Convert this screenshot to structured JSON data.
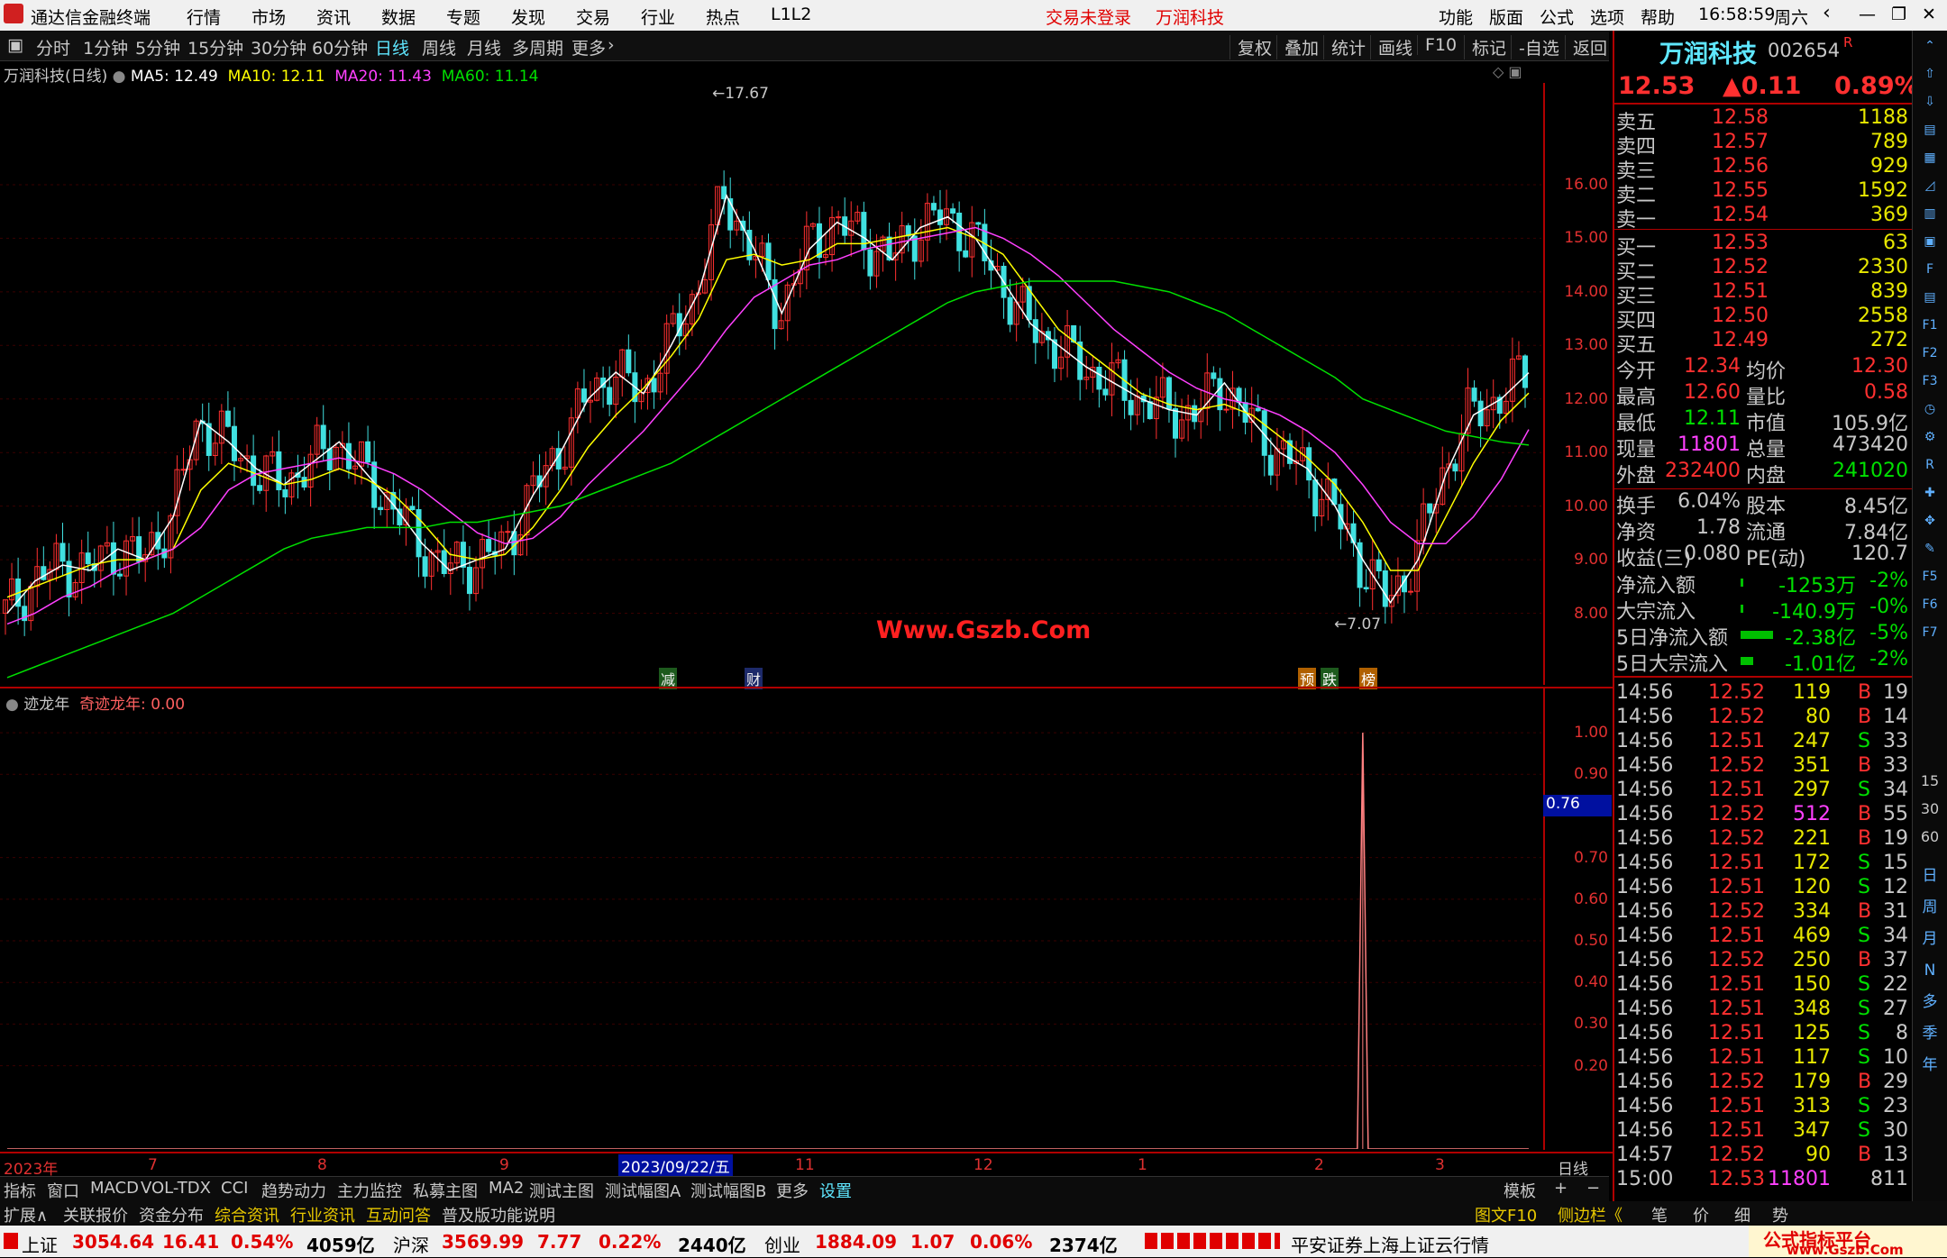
{
  "titlebar": {
    "app_title": "通达信金融终端",
    "menu": [
      "行情",
      "市场",
      "资讯",
      "数据",
      "专题",
      "发现",
      "交易",
      "行业",
      "热点",
      "L1L2"
    ],
    "trade_status": "交易未登录",
    "stock_name": "万润科技",
    "right_menu": [
      "功能",
      "版面",
      "公式",
      "选项",
      "帮助"
    ],
    "time": "16:58:59",
    "weekday": "周六"
  },
  "periodbar": {
    "periods": [
      "分时",
      "1分钟",
      "5分钟",
      "15分钟",
      "30分钟",
      "60分钟",
      "日线",
      "周线",
      "月线",
      "多周期",
      "更多"
    ],
    "selected": "日线",
    "tools": [
      "复权",
      "叠加",
      "统计",
      "画线",
      "F10",
      "标记",
      "-自选",
      "返回"
    ]
  },
  "main_chart": {
    "legend_name": "万润科技(日线)",
    "ma": [
      {
        "label": "MA5: 12.49",
        "color": "#ffffff"
      },
      {
        "label": "MA10: 12.11",
        "color": "#ffff00"
      },
      {
        "label": "MA20: 11.43",
        "color": "#ff40ff"
      },
      {
        "label": "MA60: 11.14",
        "color": "#00e000"
      }
    ],
    "high_mark": "17.67",
    "low_mark": "7.07",
    "watermark": "Www.Gszb.Com",
    "events": [
      "减",
      "财",
      "预",
      "跌",
      "榜"
    ]
  },
  "indicator": {
    "legend_name": "迹龙年",
    "legend_value": "奇迹龙年: 0.00",
    "cursor_value": "0.76"
  },
  "xaxis": {
    "labels": [
      "2023年",
      "7",
      "8",
      "9",
      "2023/09/22/五",
      "11",
      "12",
      "1",
      "2",
      "3"
    ],
    "right": "日线"
  },
  "chart_data": [
    {
      "type": "candlestick",
      "title": "万润科技(日线)",
      "y_ticks": [
        "16.00",
        "15.00",
        "14.00",
        "13.00",
        "12.00",
        "11.00",
        "10.00",
        "9.00",
        "8.00"
      ],
      "ylim": [
        7.0,
        17.9
      ],
      "series": [
        {
          "name": "MA5",
          "color": "#ffffff",
          "values": [
            8.0,
            8.6,
            8.9,
            8.8,
            9.2,
            9.0,
            9.8,
            11.6,
            11.2,
            10.7,
            10.4,
            10.8,
            11.2,
            10.6,
            10.0,
            9.3,
            8.8,
            9.0,
            9.2,
            10.2,
            11.0,
            12.0,
            12.5,
            12.1,
            13.0,
            14.0,
            15.8,
            14.8,
            13.6,
            14.8,
            15.3,
            15.0,
            14.6,
            15.2,
            15.4,
            15.0,
            14.2,
            13.4,
            13.0,
            12.6,
            12.3,
            12.0,
            11.8,
            11.7,
            12.3,
            11.6,
            11.0,
            10.7,
            10.0,
            9.0,
            8.2,
            9.0,
            10.6,
            11.7,
            12.0,
            12.49
          ]
        },
        {
          "name": "MA10",
          "color": "#ffff00",
          "values": [
            8.3,
            8.5,
            8.7,
            8.9,
            9.0,
            9.0,
            9.2,
            10.3,
            10.8,
            10.6,
            10.4,
            10.5,
            10.7,
            10.5,
            10.2,
            9.7,
            9.1,
            9.0,
            9.1,
            9.6,
            10.3,
            11.1,
            11.7,
            12.2,
            12.8,
            13.5,
            14.6,
            14.7,
            14.5,
            14.6,
            14.9,
            14.9,
            15.0,
            15.1,
            15.2,
            15.0,
            14.7,
            14.0,
            13.3,
            12.9,
            12.5,
            12.1,
            11.9,
            11.8,
            11.9,
            11.7,
            11.3,
            10.9,
            10.4,
            9.7,
            8.8,
            8.8,
            9.8,
            10.8,
            11.6,
            12.11
          ]
        },
        {
          "name": "MA20",
          "color": "#ff40ff",
          "values": [
            7.8,
            8.0,
            8.3,
            8.5,
            8.8,
            9.0,
            9.2,
            9.6,
            10.3,
            10.6,
            10.7,
            10.8,
            10.9,
            10.8,
            10.6,
            10.3,
            9.9,
            9.5,
            9.3,
            9.4,
            9.8,
            10.4,
            10.9,
            11.4,
            12.0,
            12.6,
            13.3,
            13.9,
            14.2,
            14.5,
            14.6,
            14.8,
            14.9,
            15.0,
            15.1,
            15.2,
            15.0,
            14.7,
            14.3,
            13.8,
            13.3,
            12.9,
            12.5,
            12.2,
            12.0,
            11.9,
            11.7,
            11.4,
            11.0,
            10.4,
            9.7,
            9.3,
            9.3,
            9.8,
            10.5,
            11.43
          ]
        },
        {
          "name": "MA60",
          "color": "#00e000",
          "values": [
            6.8,
            7.0,
            7.2,
            7.4,
            7.6,
            7.8,
            8.0,
            8.3,
            8.6,
            8.9,
            9.2,
            9.4,
            9.5,
            9.6,
            9.6,
            9.6,
            9.7,
            9.7,
            9.8,
            9.9,
            10.0,
            10.2,
            10.4,
            10.6,
            10.8,
            11.1,
            11.4,
            11.7,
            12.0,
            12.3,
            12.6,
            12.9,
            13.2,
            13.5,
            13.8,
            14.0,
            14.1,
            14.2,
            14.2,
            14.2,
            14.2,
            14.1,
            14.0,
            13.8,
            13.6,
            13.3,
            13.0,
            12.7,
            12.4,
            12.0,
            11.8,
            11.6,
            11.4,
            11.3,
            11.2,
            11.14
          ]
        }
      ]
    },
    {
      "type": "line",
      "title": "迹龙年",
      "y_ticks": [
        "1.00",
        "0.90",
        "0.70",
        "0.60",
        "0.50",
        "0.40",
        "0.30",
        "0.20"
      ],
      "ylim": [
        0,
        1.05
      ],
      "values": [
        0,
        0,
        0,
        0,
        0,
        0,
        0,
        0,
        0,
        0,
        0,
        0,
        0,
        0,
        0,
        0,
        0,
        0,
        0,
        0,
        0,
        0,
        0,
        0,
        0,
        0,
        0,
        0,
        0,
        0,
        0,
        0,
        0,
        0,
        0,
        0,
        0,
        0,
        0,
        0,
        0,
        0,
        0,
        0,
        0,
        0,
        0,
        0,
        0,
        1.0,
        0,
        0,
        0,
        0,
        0,
        0
      ]
    }
  ],
  "quote": {
    "name": "万润科技",
    "code": "002654",
    "mark": "R",
    "price": "12.53",
    "change": "▲0.11",
    "pct": "0.89%",
    "asks": [
      {
        "label": "卖五",
        "price": "12.58",
        "vol": "1188"
      },
      {
        "label": "卖四",
        "price": "12.57",
        "vol": "789"
      },
      {
        "label": "卖三",
        "price": "12.56",
        "vol": "929"
      },
      {
        "label": "卖二",
        "price": "12.55",
        "vol": "1592"
      },
      {
        "label": "卖一",
        "price": "12.54",
        "vol": "369"
      }
    ],
    "bids": [
      {
        "label": "买一",
        "price": "12.53",
        "vol": "63"
      },
      {
        "label": "买二",
        "price": "12.52",
        "vol": "2330"
      },
      {
        "label": "买三",
        "price": "12.51",
        "vol": "839"
      },
      {
        "label": "买四",
        "price": "12.50",
        "vol": "2558"
      },
      {
        "label": "买五",
        "price": "12.49",
        "vol": "272"
      }
    ],
    "stats1": [
      {
        "l1": "今开",
        "v1": "12.34",
        "l2": "均价",
        "v2": "12.30"
      },
      {
        "l1": "最高",
        "v1": "12.60",
        "l2": "量比",
        "v2": "0.58"
      },
      {
        "l1": "最低",
        "v1": "12.11",
        "l2": "市值",
        "v2": "105.9亿"
      },
      {
        "l1": "现量",
        "v1": "11801",
        "l2": "总量",
        "v2": "473420"
      },
      {
        "l1": "外盘",
        "v1": "232400",
        "l2": "内盘",
        "v2": "241020"
      }
    ],
    "stats2": [
      {
        "l1": "换手",
        "v1": "6.04%",
        "l2": "股本",
        "v2": "8.45亿"
      },
      {
        "l1": "净资",
        "v1": "1.78",
        "l2": "流通",
        "v2": "7.84亿"
      },
      {
        "l1": "收益(三)",
        "v1": "0.080",
        "l2": "PE(动)",
        "v2": "120.7"
      }
    ],
    "flows": [
      {
        "label": "净流入额",
        "value": "-1253万",
        "pct": "-2%"
      },
      {
        "label": "大宗流入",
        "value": "-140.9万",
        "pct": "-0%"
      },
      {
        "label": "5日净流入额",
        "value": "-2.38亿",
        "pct": "-5%"
      },
      {
        "label": "5日大宗流入",
        "value": "-1.01亿",
        "pct": "-2%"
      }
    ],
    "ticks": [
      {
        "t": "14:56",
        "p": "12.52",
        "v": "119",
        "s": "B",
        "n": "19"
      },
      {
        "t": "14:56",
        "p": "12.52",
        "v": "80",
        "s": "B",
        "n": "14"
      },
      {
        "t": "14:56",
        "p": "12.51",
        "v": "247",
        "s": "S",
        "n": "33"
      },
      {
        "t": "14:56",
        "p": "12.52",
        "v": "351",
        "s": "B",
        "n": "33"
      },
      {
        "t": "14:56",
        "p": "12.51",
        "v": "297",
        "s": "S",
        "n": "34"
      },
      {
        "t": "14:56",
        "p": "12.52",
        "v": "512",
        "s": "B",
        "n": "55"
      },
      {
        "t": "14:56",
        "p": "12.52",
        "v": "221",
        "s": "B",
        "n": "19"
      },
      {
        "t": "14:56",
        "p": "12.51",
        "v": "172",
        "s": "S",
        "n": "15"
      },
      {
        "t": "14:56",
        "p": "12.51",
        "v": "120",
        "s": "S",
        "n": "12"
      },
      {
        "t": "14:56",
        "p": "12.52",
        "v": "334",
        "s": "B",
        "n": "31"
      },
      {
        "t": "14:56",
        "p": "12.51",
        "v": "469",
        "s": "S",
        "n": "34"
      },
      {
        "t": "14:56",
        "p": "12.52",
        "v": "250",
        "s": "B",
        "n": "37"
      },
      {
        "t": "14:56",
        "p": "12.51",
        "v": "150",
        "s": "S",
        "n": "22"
      },
      {
        "t": "14:56",
        "p": "12.51",
        "v": "348",
        "s": "S",
        "n": "27"
      },
      {
        "t": "14:56",
        "p": "12.51",
        "v": "125",
        "s": "S",
        "n": "8"
      },
      {
        "t": "14:56",
        "p": "12.51",
        "v": "117",
        "s": "S",
        "n": "10"
      },
      {
        "t": "14:56",
        "p": "12.52",
        "v": "179",
        "s": "B",
        "n": "29"
      },
      {
        "t": "14:56",
        "p": "12.51",
        "v": "313",
        "s": "S",
        "n": "23"
      },
      {
        "t": "14:56",
        "p": "12.51",
        "v": "347",
        "s": "S",
        "n": "30"
      },
      {
        "t": "14:57",
        "p": "12.52",
        "v": "90",
        "s": "B",
        "n": "13"
      },
      {
        "t": "15:00",
        "p": "12.53",
        "v": "11801",
        "s": "",
        "n": "811"
      }
    ]
  },
  "vtool": [
    "日",
    "周",
    "月",
    "N",
    "多",
    "季",
    "年"
  ],
  "vtool_top": [
    "15",
    "30",
    "60"
  ],
  "tabs": [
    "指标",
    "窗口",
    "MACD",
    "VOL-TDX",
    "CCI",
    "趋势动力",
    "主力监控",
    "私募主图",
    "MA2",
    "测试主图",
    "测试幅图A",
    "测试幅图B",
    "更多",
    "设置"
  ],
  "tabs_right": [
    "模板",
    "+",
    "−"
  ],
  "extbar": [
    "扩展∧",
    "关联报价",
    "资金分布",
    "综合资讯",
    "行业资讯",
    "互动问答",
    "普及版功能说明"
  ],
  "extbar_right": [
    "图文F10",
    "侧边栏《",
    "笔",
    "价",
    "细",
    "势"
  ],
  "statusbar": {
    "sh": {
      "name": "上证",
      "price": "3054.64",
      "chg": "16.41",
      "pct": "0.54%",
      "amt": "4059亿"
    },
    "sz": {
      "name": "沪深",
      "price": "3569.99",
      "chg": "7.77",
      "pct": "0.22%",
      "amt": "2440亿"
    },
    "cy": {
      "name": "创业",
      "price": "1884.09",
      "chg": "1.07",
      "pct": "0.06%",
      "amt": "2374亿"
    },
    "msg": "平安证券上海上证云行情",
    "brand": "公式指标平台",
    "brand_url": "www.Gszb.Com"
  }
}
